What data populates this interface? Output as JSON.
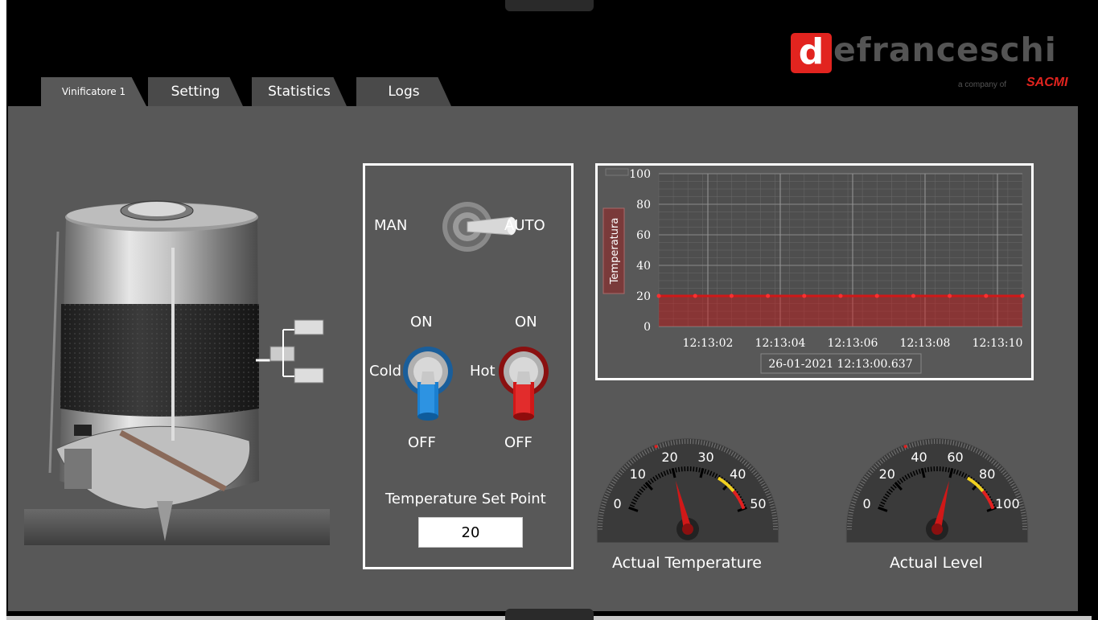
{
  "tabs": [
    {
      "label": "Vinificatore 1",
      "active": true
    },
    {
      "label": "Setting",
      "active": false
    },
    {
      "label": "Statistics",
      "active": false
    },
    {
      "label": "Logs",
      "active": false
    }
  ],
  "brand": {
    "logo_letter": "d",
    "logo_rest": "efranceschi",
    "subtitle": "a company of",
    "parent": "SACMI",
    "accent_color": "#e2241f"
  },
  "controls": {
    "mode_left": "MAN",
    "mode_right": "AUTO",
    "mode_value": "AUTO",
    "cold": {
      "on_label": "ON",
      "off_label": "OFF",
      "label": "Cold",
      "color": "#1a7fd0"
    },
    "hot": {
      "on_label": "ON",
      "off_label": "OFF",
      "label": "Hot",
      "color": "#d01818"
    },
    "setpoint_label": "Temperature Set Point",
    "setpoint_value": "20"
  },
  "chart_data": {
    "type": "area",
    "ylabel": "Temperatura",
    "ylim": [
      0,
      100
    ],
    "yticks": [
      "0",
      "20",
      "40",
      "60",
      "80",
      "100"
    ],
    "xticks": [
      "12:13:02",
      "12:13:04",
      "12:13:06",
      "12:13:08",
      "12:13:10"
    ],
    "series": [
      {
        "values": [
          20,
          20,
          20,
          20,
          20,
          20,
          20,
          20,
          20,
          20,
          20
        ],
        "color": "#d01818"
      }
    ],
    "cursor_readout": "26-01-2021  12:13:00.637"
  },
  "gauges": {
    "temperature": {
      "label": "Actual Temperature",
      "min": 0,
      "max": 50,
      "value": 20,
      "ticks": [
        "0",
        "10",
        "20",
        "30",
        "40",
        "50"
      ]
    },
    "level": {
      "label": "Actual Level",
      "min": 0,
      "max": 100,
      "value": 60,
      "ticks": [
        "0",
        "20",
        "40",
        "60",
        "80",
        "100"
      ]
    }
  }
}
